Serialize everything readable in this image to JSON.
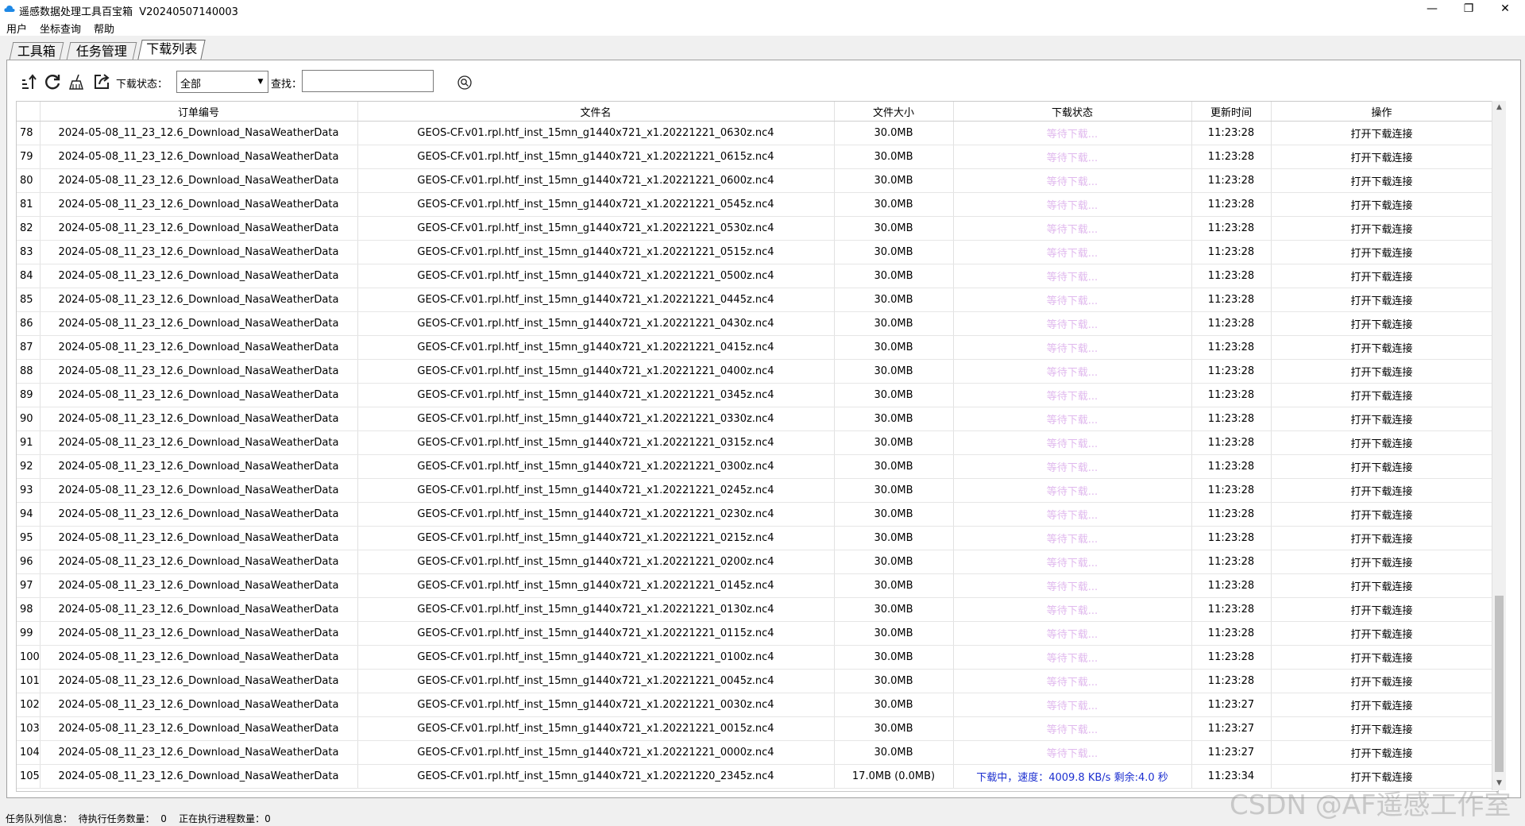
{
  "window": {
    "title": "遥感数据处理工具百宝箱  V20240507140003",
    "controls": {
      "minimize": "—",
      "maximize": "❐",
      "close": "✕"
    }
  },
  "menu": {
    "items": [
      "用户",
      "坐标查询",
      "帮助"
    ]
  },
  "tabs": [
    {
      "label": "工具箱",
      "active": false
    },
    {
      "label": "任务管理",
      "active": false
    },
    {
      "label": "下载列表",
      "active": true
    }
  ],
  "toolbar": {
    "status_label": "下载状态：",
    "status_value": "全部",
    "search_label": "查找：",
    "search_value": "",
    "icons": [
      "export-sort-icon",
      "refresh-icon",
      "clear-broom-icon",
      "open-external-icon",
      "search-icon"
    ]
  },
  "table": {
    "columns": [
      "",
      "订单编号",
      "文件名",
      "文件大小",
      "下载状态",
      "更新时间",
      "操作"
    ],
    "rows": [
      {
        "idx": "78",
        "order": "2024-05-08_11_23_12.6_Download_NasaWeatherData",
        "file": "GEOS-CF.v01.rpl.htf_inst_15mn_g1440x721_x1.20221221_0630z.nc4",
        "size": "30.0MB",
        "status": "等待下载...",
        "time": "11:23:28",
        "action": "打开下载连接",
        "state": "wait"
      },
      {
        "idx": "79",
        "order": "2024-05-08_11_23_12.6_Download_NasaWeatherData",
        "file": "GEOS-CF.v01.rpl.htf_inst_15mn_g1440x721_x1.20221221_0615z.nc4",
        "size": "30.0MB",
        "status": "等待下载...",
        "time": "11:23:28",
        "action": "打开下载连接",
        "state": "wait"
      },
      {
        "idx": "80",
        "order": "2024-05-08_11_23_12.6_Download_NasaWeatherData",
        "file": "GEOS-CF.v01.rpl.htf_inst_15mn_g1440x721_x1.20221221_0600z.nc4",
        "size": "30.0MB",
        "status": "等待下载...",
        "time": "11:23:28",
        "action": "打开下载连接",
        "state": "wait"
      },
      {
        "idx": "81",
        "order": "2024-05-08_11_23_12.6_Download_NasaWeatherData",
        "file": "GEOS-CF.v01.rpl.htf_inst_15mn_g1440x721_x1.20221221_0545z.nc4",
        "size": "30.0MB",
        "status": "等待下载...",
        "time": "11:23:28",
        "action": "打开下载连接",
        "state": "wait"
      },
      {
        "idx": "82",
        "order": "2024-05-08_11_23_12.6_Download_NasaWeatherData",
        "file": "GEOS-CF.v01.rpl.htf_inst_15mn_g1440x721_x1.20221221_0530z.nc4",
        "size": "30.0MB",
        "status": "等待下载...",
        "time": "11:23:28",
        "action": "打开下载连接",
        "state": "wait"
      },
      {
        "idx": "83",
        "order": "2024-05-08_11_23_12.6_Download_NasaWeatherData",
        "file": "GEOS-CF.v01.rpl.htf_inst_15mn_g1440x721_x1.20221221_0515z.nc4",
        "size": "30.0MB",
        "status": "等待下载...",
        "time": "11:23:28",
        "action": "打开下载连接",
        "state": "wait"
      },
      {
        "idx": "84",
        "order": "2024-05-08_11_23_12.6_Download_NasaWeatherData",
        "file": "GEOS-CF.v01.rpl.htf_inst_15mn_g1440x721_x1.20221221_0500z.nc4",
        "size": "30.0MB",
        "status": "等待下载...",
        "time": "11:23:28",
        "action": "打开下载连接",
        "state": "wait"
      },
      {
        "idx": "85",
        "order": "2024-05-08_11_23_12.6_Download_NasaWeatherData",
        "file": "GEOS-CF.v01.rpl.htf_inst_15mn_g1440x721_x1.20221221_0445z.nc4",
        "size": "30.0MB",
        "status": "等待下载...",
        "time": "11:23:28",
        "action": "打开下载连接",
        "state": "wait"
      },
      {
        "idx": "86",
        "order": "2024-05-08_11_23_12.6_Download_NasaWeatherData",
        "file": "GEOS-CF.v01.rpl.htf_inst_15mn_g1440x721_x1.20221221_0430z.nc4",
        "size": "30.0MB",
        "status": "等待下载...",
        "time": "11:23:28",
        "action": "打开下载连接",
        "state": "wait"
      },
      {
        "idx": "87",
        "order": "2024-05-08_11_23_12.6_Download_NasaWeatherData",
        "file": "GEOS-CF.v01.rpl.htf_inst_15mn_g1440x721_x1.20221221_0415z.nc4",
        "size": "30.0MB",
        "status": "等待下载...",
        "time": "11:23:28",
        "action": "打开下载连接",
        "state": "wait"
      },
      {
        "idx": "88",
        "order": "2024-05-08_11_23_12.6_Download_NasaWeatherData",
        "file": "GEOS-CF.v01.rpl.htf_inst_15mn_g1440x721_x1.20221221_0400z.nc4",
        "size": "30.0MB",
        "status": "等待下载...",
        "time": "11:23:28",
        "action": "打开下载连接",
        "state": "wait"
      },
      {
        "idx": "89",
        "order": "2024-05-08_11_23_12.6_Download_NasaWeatherData",
        "file": "GEOS-CF.v01.rpl.htf_inst_15mn_g1440x721_x1.20221221_0345z.nc4",
        "size": "30.0MB",
        "status": "等待下载...",
        "time": "11:23:28",
        "action": "打开下载连接",
        "state": "wait"
      },
      {
        "idx": "90",
        "order": "2024-05-08_11_23_12.6_Download_NasaWeatherData",
        "file": "GEOS-CF.v01.rpl.htf_inst_15mn_g1440x721_x1.20221221_0330z.nc4",
        "size": "30.0MB",
        "status": "等待下载...",
        "time": "11:23:28",
        "action": "打开下载连接",
        "state": "wait"
      },
      {
        "idx": "91",
        "order": "2024-05-08_11_23_12.6_Download_NasaWeatherData",
        "file": "GEOS-CF.v01.rpl.htf_inst_15mn_g1440x721_x1.20221221_0315z.nc4",
        "size": "30.0MB",
        "status": "等待下载...",
        "time": "11:23:28",
        "action": "打开下载连接",
        "state": "wait"
      },
      {
        "idx": "92",
        "order": "2024-05-08_11_23_12.6_Download_NasaWeatherData",
        "file": "GEOS-CF.v01.rpl.htf_inst_15mn_g1440x721_x1.20221221_0300z.nc4",
        "size": "30.0MB",
        "status": "等待下载...",
        "time": "11:23:28",
        "action": "打开下载连接",
        "state": "wait"
      },
      {
        "idx": "93",
        "order": "2024-05-08_11_23_12.6_Download_NasaWeatherData",
        "file": "GEOS-CF.v01.rpl.htf_inst_15mn_g1440x721_x1.20221221_0245z.nc4",
        "size": "30.0MB",
        "status": "等待下载...",
        "time": "11:23:28",
        "action": "打开下载连接",
        "state": "wait"
      },
      {
        "idx": "94",
        "order": "2024-05-08_11_23_12.6_Download_NasaWeatherData",
        "file": "GEOS-CF.v01.rpl.htf_inst_15mn_g1440x721_x1.20221221_0230z.nc4",
        "size": "30.0MB",
        "status": "等待下载...",
        "time": "11:23:28",
        "action": "打开下载连接",
        "state": "wait"
      },
      {
        "idx": "95",
        "order": "2024-05-08_11_23_12.6_Download_NasaWeatherData",
        "file": "GEOS-CF.v01.rpl.htf_inst_15mn_g1440x721_x1.20221221_0215z.nc4",
        "size": "30.0MB",
        "status": "等待下载...",
        "time": "11:23:28",
        "action": "打开下载连接",
        "state": "wait"
      },
      {
        "idx": "96",
        "order": "2024-05-08_11_23_12.6_Download_NasaWeatherData",
        "file": "GEOS-CF.v01.rpl.htf_inst_15mn_g1440x721_x1.20221221_0200z.nc4",
        "size": "30.0MB",
        "status": "等待下载...",
        "time": "11:23:28",
        "action": "打开下载连接",
        "state": "wait"
      },
      {
        "idx": "97",
        "order": "2024-05-08_11_23_12.6_Download_NasaWeatherData",
        "file": "GEOS-CF.v01.rpl.htf_inst_15mn_g1440x721_x1.20221221_0145z.nc4",
        "size": "30.0MB",
        "status": "等待下载...",
        "time": "11:23:28",
        "action": "打开下载连接",
        "state": "wait"
      },
      {
        "idx": "98",
        "order": "2024-05-08_11_23_12.6_Download_NasaWeatherData",
        "file": "GEOS-CF.v01.rpl.htf_inst_15mn_g1440x721_x1.20221221_0130z.nc4",
        "size": "30.0MB",
        "status": "等待下载...",
        "time": "11:23:28",
        "action": "打开下载连接",
        "state": "wait"
      },
      {
        "idx": "99",
        "order": "2024-05-08_11_23_12.6_Download_NasaWeatherData",
        "file": "GEOS-CF.v01.rpl.htf_inst_15mn_g1440x721_x1.20221221_0115z.nc4",
        "size": "30.0MB",
        "status": "等待下载...",
        "time": "11:23:28",
        "action": "打开下载连接",
        "state": "wait"
      },
      {
        "idx": "100",
        "order": "2024-05-08_11_23_12.6_Download_NasaWeatherData",
        "file": "GEOS-CF.v01.rpl.htf_inst_15mn_g1440x721_x1.20221221_0100z.nc4",
        "size": "30.0MB",
        "status": "等待下载...",
        "time": "11:23:28",
        "action": "打开下载连接",
        "state": "wait"
      },
      {
        "idx": "101",
        "order": "2024-05-08_11_23_12.6_Download_NasaWeatherData",
        "file": "GEOS-CF.v01.rpl.htf_inst_15mn_g1440x721_x1.20221221_0045z.nc4",
        "size": "30.0MB",
        "status": "等待下载...",
        "time": "11:23:28",
        "action": "打开下载连接",
        "state": "wait"
      },
      {
        "idx": "102",
        "order": "2024-05-08_11_23_12.6_Download_NasaWeatherData",
        "file": "GEOS-CF.v01.rpl.htf_inst_15mn_g1440x721_x1.20221221_0030z.nc4",
        "size": "30.0MB",
        "status": "等待下载...",
        "time": "11:23:27",
        "action": "打开下载连接",
        "state": "wait"
      },
      {
        "idx": "103",
        "order": "2024-05-08_11_23_12.6_Download_NasaWeatherData",
        "file": "GEOS-CF.v01.rpl.htf_inst_15mn_g1440x721_x1.20221221_0015z.nc4",
        "size": "30.0MB",
        "status": "等待下载...",
        "time": "11:23:27",
        "action": "打开下载连接",
        "state": "wait"
      },
      {
        "idx": "104",
        "order": "2024-05-08_11_23_12.6_Download_NasaWeatherData",
        "file": "GEOS-CF.v01.rpl.htf_inst_15mn_g1440x721_x1.20221221_0000z.nc4",
        "size": "30.0MB",
        "status": "等待下载...",
        "time": "11:23:27",
        "action": "打开下载连接",
        "state": "wait"
      },
      {
        "idx": "105",
        "order": "2024-05-08_11_23_12.6_Download_NasaWeatherData",
        "file": "GEOS-CF.v01.rpl.htf_inst_15mn_g1440x721_x1.20221220_2345z.nc4",
        "size": "17.0MB (0.0MB)",
        "status": "下载中，速度：4009.8 KB/s 剩余:4.0 秒",
        "time": "11:23:34",
        "action": "打开下载连接",
        "state": "active"
      }
    ]
  },
  "status_bar": {
    "text": "任务队列信息：  待执行任务数量：  0    正在执行进程数量：0"
  },
  "watermark": "CSDN @AF遥感工作室",
  "colors": {
    "waiting": "#e0b8ee",
    "downloading": "#1c2fd0"
  }
}
